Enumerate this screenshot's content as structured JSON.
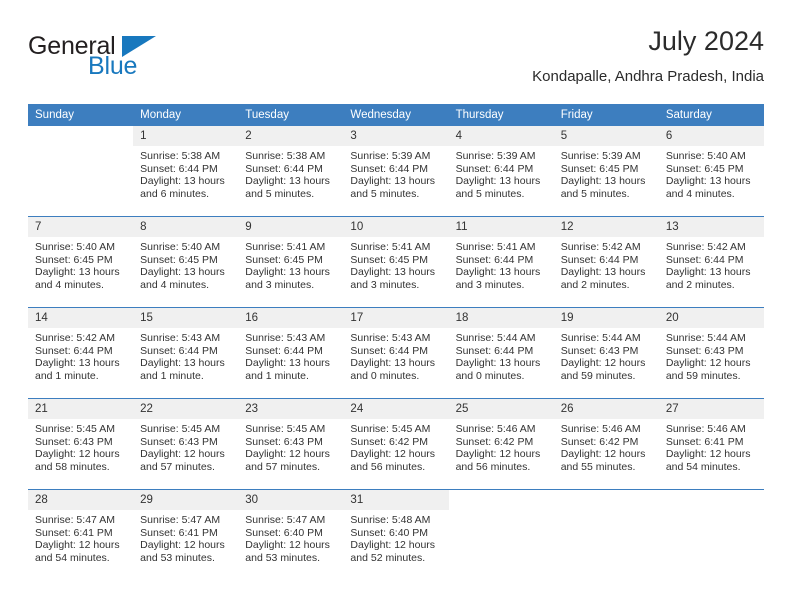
{
  "brand": {
    "word1": "General",
    "word2": "Blue",
    "flag_icon": "blue-triangle-flag",
    "primary_color": "#1878be"
  },
  "header": {
    "title": "July 2024",
    "subtitle": "Kondapalle, Andhra Pradesh, India"
  },
  "theme": {
    "header_blue": "#3d7ebf",
    "daynum_band": "#f0f0f0",
    "text": "#333333"
  },
  "calendar": {
    "weekday_headers": [
      "Sunday",
      "Monday",
      "Tuesday",
      "Wednesday",
      "Thursday",
      "Friday",
      "Saturday"
    ],
    "weeks": [
      [
        {
          "day": "",
          "sunrise": "",
          "sunset": "",
          "daylight_line1": "",
          "daylight_line2": "",
          "blank": true
        },
        {
          "day": "1",
          "sunrise": "Sunrise: 5:38 AM",
          "sunset": "Sunset: 6:44 PM",
          "daylight_line1": "Daylight: 13 hours",
          "daylight_line2": "and 6 minutes."
        },
        {
          "day": "2",
          "sunrise": "Sunrise: 5:38 AM",
          "sunset": "Sunset: 6:44 PM",
          "daylight_line1": "Daylight: 13 hours",
          "daylight_line2": "and 5 minutes."
        },
        {
          "day": "3",
          "sunrise": "Sunrise: 5:39 AM",
          "sunset": "Sunset: 6:44 PM",
          "daylight_line1": "Daylight: 13 hours",
          "daylight_line2": "and 5 minutes."
        },
        {
          "day": "4",
          "sunrise": "Sunrise: 5:39 AM",
          "sunset": "Sunset: 6:44 PM",
          "daylight_line1": "Daylight: 13 hours",
          "daylight_line2": "and 5 minutes."
        },
        {
          "day": "5",
          "sunrise": "Sunrise: 5:39 AM",
          "sunset": "Sunset: 6:45 PM",
          "daylight_line1": "Daylight: 13 hours",
          "daylight_line2": "and 5 minutes."
        },
        {
          "day": "6",
          "sunrise": "Sunrise: 5:40 AM",
          "sunset": "Sunset: 6:45 PM",
          "daylight_line1": "Daylight: 13 hours",
          "daylight_line2": "and 4 minutes."
        }
      ],
      [
        {
          "day": "7",
          "sunrise": "Sunrise: 5:40 AM",
          "sunset": "Sunset: 6:45 PM",
          "daylight_line1": "Daylight: 13 hours",
          "daylight_line2": "and 4 minutes."
        },
        {
          "day": "8",
          "sunrise": "Sunrise: 5:40 AM",
          "sunset": "Sunset: 6:45 PM",
          "daylight_line1": "Daylight: 13 hours",
          "daylight_line2": "and 4 minutes."
        },
        {
          "day": "9",
          "sunrise": "Sunrise: 5:41 AM",
          "sunset": "Sunset: 6:45 PM",
          "daylight_line1": "Daylight: 13 hours",
          "daylight_line2": "and 3 minutes."
        },
        {
          "day": "10",
          "sunrise": "Sunrise: 5:41 AM",
          "sunset": "Sunset: 6:45 PM",
          "daylight_line1": "Daylight: 13 hours",
          "daylight_line2": "and 3 minutes."
        },
        {
          "day": "11",
          "sunrise": "Sunrise: 5:41 AM",
          "sunset": "Sunset: 6:44 PM",
          "daylight_line1": "Daylight: 13 hours",
          "daylight_line2": "and 3 minutes."
        },
        {
          "day": "12",
          "sunrise": "Sunrise: 5:42 AM",
          "sunset": "Sunset: 6:44 PM",
          "daylight_line1": "Daylight: 13 hours",
          "daylight_line2": "and 2 minutes."
        },
        {
          "day": "13",
          "sunrise": "Sunrise: 5:42 AM",
          "sunset": "Sunset: 6:44 PM",
          "daylight_line1": "Daylight: 13 hours",
          "daylight_line2": "and 2 minutes."
        }
      ],
      [
        {
          "day": "14",
          "sunrise": "Sunrise: 5:42 AM",
          "sunset": "Sunset: 6:44 PM",
          "daylight_line1": "Daylight: 13 hours",
          "daylight_line2": "and 1 minute."
        },
        {
          "day": "15",
          "sunrise": "Sunrise: 5:43 AM",
          "sunset": "Sunset: 6:44 PM",
          "daylight_line1": "Daylight: 13 hours",
          "daylight_line2": "and 1 minute."
        },
        {
          "day": "16",
          "sunrise": "Sunrise: 5:43 AM",
          "sunset": "Sunset: 6:44 PM",
          "daylight_line1": "Daylight: 13 hours",
          "daylight_line2": "and 1 minute."
        },
        {
          "day": "17",
          "sunrise": "Sunrise: 5:43 AM",
          "sunset": "Sunset: 6:44 PM",
          "daylight_line1": "Daylight: 13 hours",
          "daylight_line2": "and 0 minutes."
        },
        {
          "day": "18",
          "sunrise": "Sunrise: 5:44 AM",
          "sunset": "Sunset: 6:44 PM",
          "daylight_line1": "Daylight: 13 hours",
          "daylight_line2": "and 0 minutes."
        },
        {
          "day": "19",
          "sunrise": "Sunrise: 5:44 AM",
          "sunset": "Sunset: 6:43 PM",
          "daylight_line1": "Daylight: 12 hours",
          "daylight_line2": "and 59 minutes."
        },
        {
          "day": "20",
          "sunrise": "Sunrise: 5:44 AM",
          "sunset": "Sunset: 6:43 PM",
          "daylight_line1": "Daylight: 12 hours",
          "daylight_line2": "and 59 minutes."
        }
      ],
      [
        {
          "day": "21",
          "sunrise": "Sunrise: 5:45 AM",
          "sunset": "Sunset: 6:43 PM",
          "daylight_line1": "Daylight: 12 hours",
          "daylight_line2": "and 58 minutes."
        },
        {
          "day": "22",
          "sunrise": "Sunrise: 5:45 AM",
          "sunset": "Sunset: 6:43 PM",
          "daylight_line1": "Daylight: 12 hours",
          "daylight_line2": "and 57 minutes."
        },
        {
          "day": "23",
          "sunrise": "Sunrise: 5:45 AM",
          "sunset": "Sunset: 6:43 PM",
          "daylight_line1": "Daylight: 12 hours",
          "daylight_line2": "and 57 minutes."
        },
        {
          "day": "24",
          "sunrise": "Sunrise: 5:45 AM",
          "sunset": "Sunset: 6:42 PM",
          "daylight_line1": "Daylight: 12 hours",
          "daylight_line2": "and 56 minutes."
        },
        {
          "day": "25",
          "sunrise": "Sunrise: 5:46 AM",
          "sunset": "Sunset: 6:42 PM",
          "daylight_line1": "Daylight: 12 hours",
          "daylight_line2": "and 56 minutes."
        },
        {
          "day": "26",
          "sunrise": "Sunrise: 5:46 AM",
          "sunset": "Sunset: 6:42 PM",
          "daylight_line1": "Daylight: 12 hours",
          "daylight_line2": "and 55 minutes."
        },
        {
          "day": "27",
          "sunrise": "Sunrise: 5:46 AM",
          "sunset": "Sunset: 6:41 PM",
          "daylight_line1": "Daylight: 12 hours",
          "daylight_line2": "and 54 minutes."
        }
      ],
      [
        {
          "day": "28",
          "sunrise": "Sunrise: 5:47 AM",
          "sunset": "Sunset: 6:41 PM",
          "daylight_line1": "Daylight: 12 hours",
          "daylight_line2": "and 54 minutes."
        },
        {
          "day": "29",
          "sunrise": "Sunrise: 5:47 AM",
          "sunset": "Sunset: 6:41 PM",
          "daylight_line1": "Daylight: 12 hours",
          "daylight_line2": "and 53 minutes."
        },
        {
          "day": "30",
          "sunrise": "Sunrise: 5:47 AM",
          "sunset": "Sunset: 6:40 PM",
          "daylight_line1": "Daylight: 12 hours",
          "daylight_line2": "and 53 minutes."
        },
        {
          "day": "31",
          "sunrise": "Sunrise: 5:48 AM",
          "sunset": "Sunset: 6:40 PM",
          "daylight_line1": "Daylight: 12 hours",
          "daylight_line2": "and 52 minutes."
        },
        {
          "day": "",
          "sunrise": "",
          "sunset": "",
          "daylight_line1": "",
          "daylight_line2": "",
          "blank": true
        },
        {
          "day": "",
          "sunrise": "",
          "sunset": "",
          "daylight_line1": "",
          "daylight_line2": "",
          "blank": true
        },
        {
          "day": "",
          "sunrise": "",
          "sunset": "",
          "daylight_line1": "",
          "daylight_line2": "",
          "blank": true
        }
      ]
    ]
  }
}
